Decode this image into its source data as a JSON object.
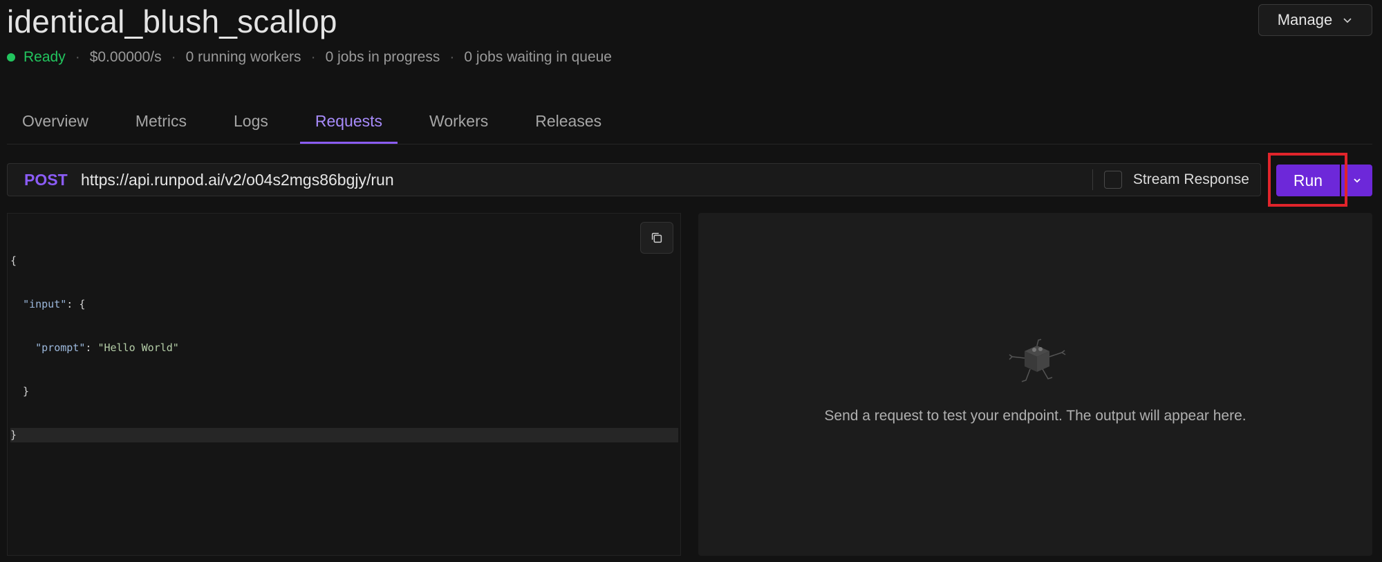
{
  "header": {
    "title": "identical_blush_scallop",
    "manage_label": "Manage"
  },
  "status": {
    "state": "Ready",
    "cost": "$0.00000/s",
    "running_workers": "0 running workers",
    "jobs_in_progress": "0 jobs in progress",
    "jobs_in_queue": "0 jobs waiting in queue",
    "colors": {
      "ready": "#22c55e"
    }
  },
  "tabs": [
    {
      "label": "Overview"
    },
    {
      "label": "Metrics"
    },
    {
      "label": "Logs"
    },
    {
      "label": "Requests",
      "active": true
    },
    {
      "label": "Workers"
    },
    {
      "label": "Releases"
    }
  ],
  "request": {
    "method": "POST",
    "url": "https://api.runpod.ai/v2/o04s2mgs86bgjy/run",
    "stream_label": "Stream Response",
    "stream_checked": false,
    "run_label": "Run"
  },
  "editor": {
    "lines": [
      "{",
      "  \"input\": {",
      "    \"prompt\": \"Hello World\"",
      "  }",
      "}"
    ]
  },
  "output": {
    "placeholder": "Send a request to test your endpoint. The output will appear here."
  },
  "icons": {
    "manage_caret": "chevron-down-icon",
    "run_caret": "chevron-down-icon",
    "copy": "copy-icon",
    "empty_state": "robot-mascot-icon"
  },
  "theme": {
    "accent": "#6d28d9",
    "accent_text": "#a78bfa",
    "highlight": "#e0242b"
  }
}
